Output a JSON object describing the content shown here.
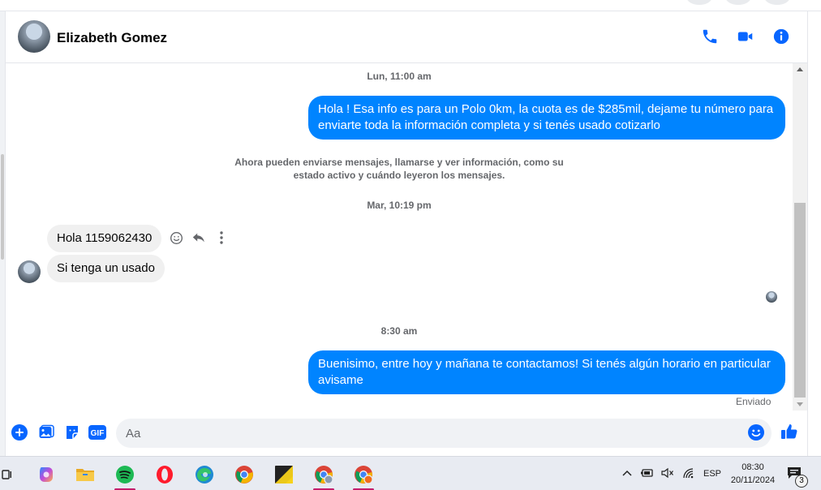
{
  "contact": {
    "name": "Elizabeth Gomez"
  },
  "header_actions": [
    "phone-icon",
    "video-camera-icon",
    "info-icon"
  ],
  "conversation": {
    "timestamps": {
      "t1": "Lun, 11:00 am",
      "t2": "Mar, 10:19 pm",
      "t3": "8:30 am"
    },
    "msg_out_1": "Hola ! Esa info es para un Polo 0km, la cuota es de $285mil, dejame tu número para enviarte toda la información completa y si tenés usado cotizarlo",
    "system_note": "Ahora pueden enviarse mensajes, llamarse y ver información, como su estado activo y cuándo leyeron los mensajes.",
    "msg_in_1": "Hola 1159062430",
    "msg_in_2": "Si tenga un usado",
    "msg_out_2": "Buenisimo, entre hoy y mañana te contactamos! Si tenés algún horario en particular avisame",
    "status": "Enviado"
  },
  "message_actions": [
    "emoji-react-icon",
    "reply-icon",
    "more-options-icon"
  ],
  "composer": {
    "placeholder": "Aa",
    "buttons": [
      "plus-icon",
      "image-icon",
      "sticker-icon",
      "gif-icon"
    ],
    "gif_label": "GIF"
  },
  "taskbar": {
    "apps": [
      "copilot",
      "file-explorer",
      "spotify",
      "opera",
      "edge",
      "chrome",
      "sticky-app",
      "chrome-profile-1",
      "chrome-profile-2"
    ],
    "tray": {
      "language": "ESP",
      "time": "08:30",
      "date": "20/11/2024",
      "notifications": "3"
    }
  },
  "colors": {
    "accent": "#0084ff",
    "incoming_bubble": "#f0f0f0",
    "icon_blue": "#0866ff"
  }
}
